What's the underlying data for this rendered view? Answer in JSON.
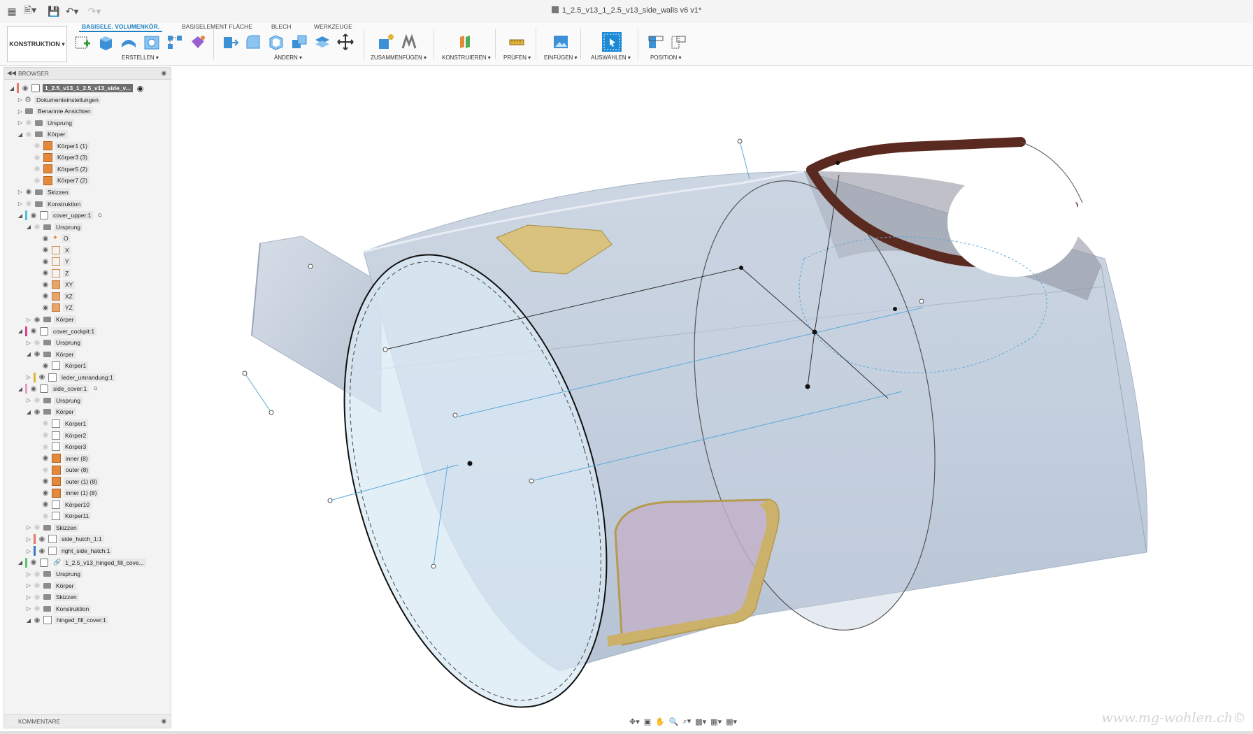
{
  "app": {
    "document_title": "1_2.5_v13_1_2.5_v13_side_walls v6 v1*"
  },
  "ribbon": {
    "workspace": "KONSTRUKTION ▾",
    "tabs": [
      "BASISELE. VOLUMENKÖR.",
      "BASISELEMENT FLÄCHE",
      "BLECH",
      "WERKZEUGE"
    ],
    "groups": [
      "ERSTELLEN ▾",
      "ÄNDERN ▾",
      "ZUSAMMENFÜGEN ▾",
      "KONSTRUIEREN ▾",
      "PRÜFEN ▾",
      "EINFÜGEN ▾",
      "AUSWÄHLEN ▾",
      "POSITION ▾"
    ]
  },
  "browser": {
    "title": "BROWSER",
    "comments": "KOMMENTARE",
    "items": [
      {
        "label": "1_2.5_v13_1_2.5_v13_side_v...",
        "level": 0,
        "exp": "open",
        "icon": "comp",
        "color": "#e07b6a",
        "root": true
      },
      {
        "label": "Dokumenteinstellungen",
        "level": 1,
        "exp": "closed",
        "icon": "gear",
        "noeye": true
      },
      {
        "label": "Benannte Ansichten",
        "level": 1,
        "exp": "closed",
        "icon": "fold",
        "noeye": true
      },
      {
        "label": "Ursprung",
        "level": 1,
        "exp": "closed",
        "icon": "fold",
        "eye": "off"
      },
      {
        "label": "Körper",
        "level": 1,
        "exp": "open",
        "icon": "fold",
        "eye": "off"
      },
      {
        "label": "Körper1 (1)",
        "level": 2,
        "icon": "body-o",
        "eye": "off"
      },
      {
        "label": "Körper3 (3)",
        "level": 2,
        "icon": "body-o",
        "eye": "off"
      },
      {
        "label": "Körper5 (2)",
        "level": 2,
        "icon": "body-o",
        "eye": "off"
      },
      {
        "label": "Körper7 (2)",
        "level": 2,
        "icon": "body-o",
        "eye": "off"
      },
      {
        "label": "Skizzen",
        "level": 1,
        "exp": "closed",
        "icon": "fold",
        "eye": "on"
      },
      {
        "label": "Konstruktion",
        "level": 1,
        "exp": "closed",
        "icon": "fold",
        "eye": "off"
      },
      {
        "label": "cover_upper:1",
        "level": 1,
        "exp": "open",
        "icon": "comp",
        "eye": "on",
        "color": "#4fc3d6",
        "radio": true
      },
      {
        "label": "Ursprung",
        "level": 2,
        "exp": "open",
        "icon": "fold",
        "eye": "off"
      },
      {
        "label": "O",
        "level": 3,
        "icon": "orig",
        "eye": "on"
      },
      {
        "label": "X",
        "level": 3,
        "icon": "axis",
        "eye": "on"
      },
      {
        "label": "Y",
        "level": 3,
        "icon": "axis",
        "eye": "on"
      },
      {
        "label": "Z",
        "level": 3,
        "icon": "axis",
        "eye": "on"
      },
      {
        "label": "XY",
        "level": 3,
        "icon": "plane",
        "eye": "on"
      },
      {
        "label": "XZ",
        "level": 3,
        "icon": "plane",
        "eye": "on"
      },
      {
        "label": "YZ",
        "level": 3,
        "icon": "plane",
        "eye": "on"
      },
      {
        "label": "Körper",
        "level": 2,
        "exp": "closed",
        "icon": "fold",
        "eye": "on"
      },
      {
        "label": "cover_cockpit:1",
        "level": 1,
        "exp": "open",
        "icon": "comp",
        "eye": "on",
        "color": "#d9418a"
      },
      {
        "label": "Ursprung",
        "level": 2,
        "exp": "closed",
        "icon": "fold",
        "eye": "off"
      },
      {
        "label": "Körper",
        "level": 2,
        "exp": "open",
        "icon": "fold",
        "eye": "on"
      },
      {
        "label": "Körper1",
        "level": 3,
        "icon": "body-w",
        "eye": "on"
      },
      {
        "label": "leder_umrandung:1",
        "level": 2,
        "exp": "closed",
        "icon": "body-w",
        "eye": "on",
        "color": "#e0b33a"
      },
      {
        "label": "side_cover:1",
        "level": 1,
        "exp": "open",
        "icon": "comp",
        "eye": "on",
        "color": "#e6a0c4",
        "radio": true
      },
      {
        "label": "Ursprung",
        "level": 2,
        "exp": "closed",
        "icon": "fold",
        "eye": "off"
      },
      {
        "label": "Körper",
        "level": 2,
        "exp": "open",
        "icon": "fold",
        "eye": "on"
      },
      {
        "label": "Körper1",
        "level": 3,
        "icon": "body-w",
        "eye": "off"
      },
      {
        "label": "Körper2",
        "level": 3,
        "icon": "body-w",
        "eye": "off"
      },
      {
        "label": "Körper3",
        "level": 3,
        "icon": "body-w",
        "eye": "off"
      },
      {
        "label": "inner (8)",
        "level": 3,
        "icon": "body-o",
        "eye": "on"
      },
      {
        "label": "outer (8)",
        "level": 3,
        "icon": "body-o",
        "eye": "off"
      },
      {
        "label": "outer (1) (8)",
        "level": 3,
        "icon": "body-o",
        "eye": "on"
      },
      {
        "label": "inner (1) (8)",
        "level": 3,
        "icon": "body-o",
        "eye": "on"
      },
      {
        "label": "Körper10",
        "level": 3,
        "icon": "body-w",
        "eye": "on"
      },
      {
        "label": "Körper11",
        "level": 3,
        "icon": "body-w",
        "eye": "off"
      },
      {
        "label": "Skizzen",
        "level": 2,
        "exp": "closed",
        "icon": "fold",
        "eye": "off"
      },
      {
        "label": "side_hutch_1:1",
        "level": 2,
        "exp": "closed",
        "icon": "body-w",
        "eye": "on",
        "color": "#e07b6a"
      },
      {
        "label": "right_side_hatch:1",
        "level": 2,
        "exp": "closed",
        "icon": "body-w",
        "eye": "on",
        "color": "#3a78c8"
      },
      {
        "label": "1_2.5_v13_hinged_fill_cove...",
        "level": 1,
        "exp": "open",
        "icon": "comp",
        "eye": "on",
        "color": "#5bc86a",
        "link": true
      },
      {
        "label": "Ursprung",
        "level": 2,
        "exp": "closed",
        "icon": "fold",
        "eye": "off"
      },
      {
        "label": "Körper",
        "level": 2,
        "exp": "closed",
        "icon": "fold",
        "eye": "off"
      },
      {
        "label": "Skizzen",
        "level": 2,
        "exp": "closed",
        "icon": "fold",
        "eye": "off"
      },
      {
        "label": "Konstruktion",
        "level": 2,
        "exp": "closed",
        "icon": "fold",
        "eye": "off"
      },
      {
        "label": "hinged_fill_cover:1",
        "level": 2,
        "exp": "open",
        "icon": "body-w",
        "eye": "on"
      }
    ]
  },
  "watermark": "www.mg-wohlen.ch©"
}
